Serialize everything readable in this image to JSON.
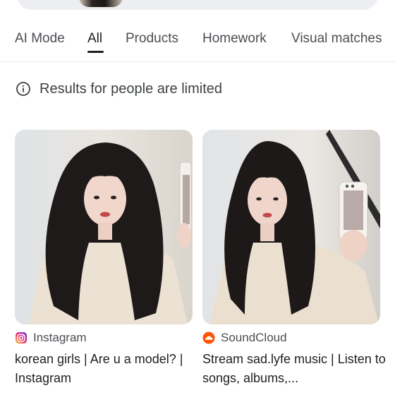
{
  "tabs": [
    {
      "label": "AI Mode",
      "active": false
    },
    {
      "label": "All",
      "active": true
    },
    {
      "label": "Products",
      "active": false
    },
    {
      "label": "Homework",
      "active": false
    },
    {
      "label": "Visual matches",
      "active": false
    }
  ],
  "notice": {
    "text": "Results for people are limited",
    "icon": "info-icon"
  },
  "results": [
    {
      "source": "Instagram",
      "source_icon": "instagram-icon",
      "title": "korean girls | Are u a model? | Instagram"
    },
    {
      "source": "SoundCloud",
      "source_icon": "soundcloud-icon",
      "title": "Stream sad.lyfe music | Listen to songs, albums,..."
    }
  ],
  "colors": {
    "instagram_gradient": [
      "#f9ce34",
      "#ee2a7b",
      "#6228d7"
    ],
    "soundcloud": "#ff5500",
    "active_tab_underline": "#1f1f1f"
  }
}
